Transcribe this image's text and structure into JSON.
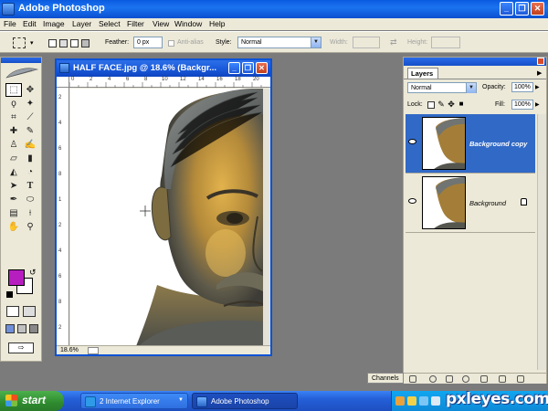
{
  "app": {
    "title": "Adobe Photoshop"
  },
  "window_controls": {
    "minimize": "_",
    "restore": "❐",
    "close": "✕"
  },
  "menu": [
    "File",
    "Edit",
    "Image",
    "Layer",
    "Select",
    "Filter",
    "View",
    "Window",
    "Help"
  ],
  "options_bar": {
    "feather_label": "Feather:",
    "feather_value": "0 px",
    "antialias_label": "Anti-alias",
    "style_label": "Style:",
    "style_value": "Normal",
    "width_label": "Width:",
    "height_label": "Height:"
  },
  "document": {
    "title": "HALF FACE.jpg @ 18.6% (Backgr...",
    "zoom": "18.6%",
    "ruler_top": [
      "0",
      "2",
      "4",
      "6",
      "8",
      "10",
      "12",
      "14",
      "16",
      "18",
      "20"
    ],
    "ruler_left": [
      "2",
      "4",
      "6",
      "8",
      "1",
      "2",
      "4",
      "6",
      "8",
      "2"
    ]
  },
  "layers_panel": {
    "tab": "Layers",
    "blend_mode": "Normal",
    "opacity_label": "Opacity:",
    "opacity_value": "100%",
    "lock_label": "Lock:",
    "fill_label": "Fill:",
    "fill_value": "100%",
    "layers": [
      {
        "name": "Background copy",
        "selected": true
      },
      {
        "name": "Background",
        "selected": false,
        "locked": true
      }
    ]
  },
  "channels_tab": "Channels",
  "tool_colors": {
    "foreground": "#b71ec0",
    "background": "#ffffff"
  },
  "taskbar": {
    "start": "start",
    "tasks": [
      "2 Internet Explorer",
      "Adobe Photoshop"
    ]
  },
  "watermark": "pxleyes.com"
}
